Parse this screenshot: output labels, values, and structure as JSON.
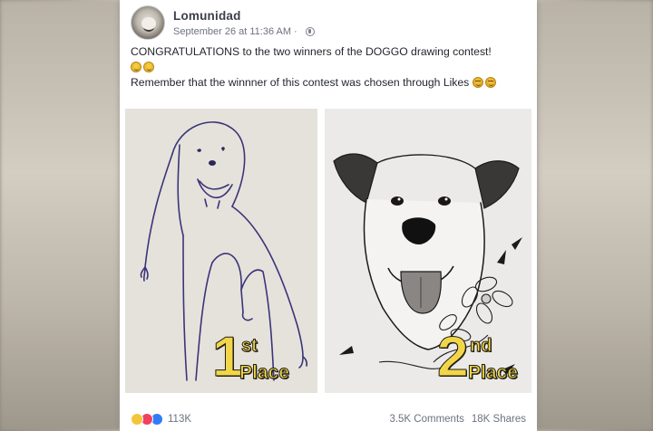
{
  "post": {
    "page_name": "Lomunidad",
    "timestamp": "September 26 at 11:36 AM",
    "separator": "·",
    "privacy_icon": "globe-icon",
    "line1": "CONGRATULATIONS to the two winners of the DOGGO drawing contest!",
    "line2": "Remember that the winnner of this contest was chosen through Likes",
    "images": {
      "first": {
        "number": "1",
        "suffix": "st",
        "word": "Place"
      },
      "second": {
        "number": "2",
        "suffix": "nd",
        "word": "Place"
      }
    },
    "reactions": {
      "icons": [
        "haha-reaction-icon",
        "love-reaction-icon",
        "like-reaction-icon"
      ],
      "count": "113K"
    },
    "comments": "3.5K Comments",
    "shares": "18K Shares"
  }
}
